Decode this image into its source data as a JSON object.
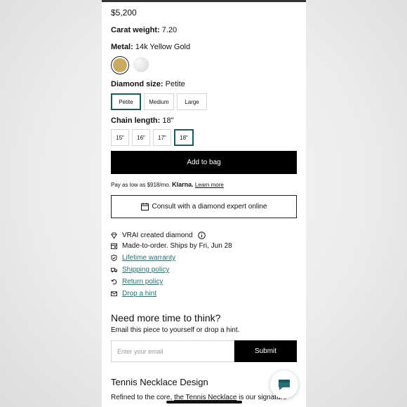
{
  "product": {
    "price": "$5,200",
    "carat_label": "Carat weight:",
    "carat_value": "7.20",
    "metal_label": "Metal:",
    "metal_value": "14k Yellow Gold",
    "metal_swatches": [
      {
        "name": "yellow-gold",
        "color": "#cba963"
      },
      {
        "name": "white-gold",
        "color": "#e4e4e4"
      }
    ],
    "diamond_size_label": "Diamond size:",
    "diamond_size_value": "Petite",
    "diamond_sizes": [
      "Petite",
      "Medium",
      "Large"
    ],
    "chain_label": "Chain length:",
    "chain_value": "18\"",
    "chain_lengths": [
      "15\"",
      "16\"",
      "17\"",
      "18\""
    ]
  },
  "actions": {
    "add_to_bag": "Add to bag",
    "klarna_prefix": "Pay as low as $918/mo.",
    "klarna_brand": "Klarna.",
    "klarna_learn": "Learn more",
    "consult": "Consult with a diamond expert online"
  },
  "features": [
    {
      "icon": "diamond-icon",
      "text": "VRAI created diamond",
      "link": false,
      "info": true
    },
    {
      "icon": "calendar-icon",
      "text": "Made-to-order. Ships by Fri, Jun 28",
      "link": false
    },
    {
      "icon": "shield-check-icon",
      "text": "Lifetime warranty",
      "link": true
    },
    {
      "icon": "truck-icon",
      "text": "Shipping policy",
      "link": true
    },
    {
      "icon": "return-icon",
      "text": "Return policy",
      "link": true
    },
    {
      "icon": "envelope-icon",
      "text": "Drop a hint",
      "link": true
    }
  ],
  "email_section": {
    "title": "Need more time to think?",
    "subtitle": "Email this piece to yourself or drop a hint.",
    "placeholder": "Enter your email",
    "submit": "Submit"
  },
  "design_section": {
    "title": "Tennis Necklace Design",
    "text_prefix": "Refined to the core,",
    "text_link": "the Tennis Necklace",
    "text_suffix": "is our signature"
  }
}
